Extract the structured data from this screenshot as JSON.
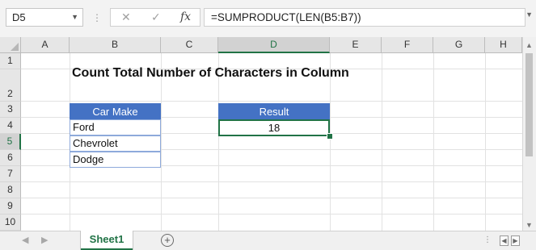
{
  "formula_bar": {
    "name_box": "D5",
    "formula": "=SUMPRODUCT(LEN(B5:B7))"
  },
  "columns": [
    "A",
    "B",
    "C",
    "D",
    "E",
    "F",
    "G",
    "H"
  ],
  "rows": [
    "1",
    "2",
    "3",
    "4",
    "5",
    "6",
    "7",
    "8",
    "9",
    "10"
  ],
  "selected_cell": "D5",
  "content": {
    "title": "Count Total Number of Characters in Column",
    "car_make_header": "Car Make",
    "car_makes": [
      "Ford",
      "Chevrolet",
      "Dodge"
    ],
    "result_header": "Result",
    "result_value": "18"
  },
  "sheet_tabs": [
    "Sheet1"
  ],
  "colors": {
    "header_fill": "#4472c4",
    "accent": "#217346",
    "table_border": "#8eaadb"
  }
}
